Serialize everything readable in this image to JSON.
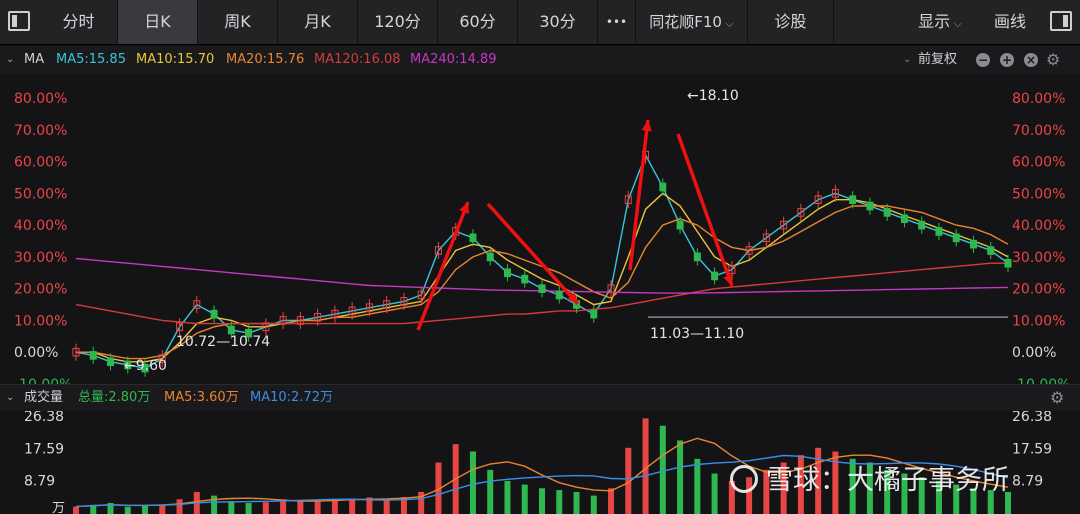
{
  "toolbar": {
    "tabs": [
      "分时",
      "日K",
      "周K",
      "月K",
      "120分",
      "60分",
      "30分",
      "•••",
      "同花顺F10",
      "诊股"
    ],
    "active_tab": "日K",
    "right_items": [
      "显示",
      "画线"
    ]
  },
  "ma_bar": {
    "label": "MA",
    "items": [
      {
        "text": "MA5:15.85",
        "color": "#36c6d9"
      },
      {
        "text": "MA10:15.70",
        "color": "#e8c63a"
      },
      {
        "text": "MA20:15.76",
        "color": "#e8862e"
      },
      {
        "text": "MA120:16.08",
        "color": "#d43b3b"
      },
      {
        "text": "MA240:14.89",
        "color": "#c737c7"
      }
    ],
    "adjust_label": "前复权"
  },
  "vol_bar": {
    "label": "成交量",
    "items": [
      {
        "text": "总量:2.80万",
        "color": "#2fb84f"
      },
      {
        "text": "MA5:3.60万",
        "color": "#e8862e"
      },
      {
        "text": "MA10:2.72万",
        "color": "#3a8ee6"
      }
    ]
  },
  "watermark": "雪球：大橘子事务所",
  "chart_data": [
    {
      "type": "candlestick",
      "title": "",
      "y_axis_ticks": [
        "80.00%",
        "70.00%",
        "60.00%",
        "50.00%",
        "40.00%",
        "30.00%",
        "20.00%",
        "10.00%",
        "0.00%",
        "-10.00%"
      ],
      "ylim": [
        -10,
        80
      ],
      "annotations": [
        "←18.10",
        "10.72—10.74",
        "←9.60",
        "11.03—11.10"
      ],
      "ma_series": [
        {
          "name": "MA5",
          "color": "#36c6d9",
          "values": [
            0,
            -1,
            -3,
            -4,
            -5,
            -2,
            8,
            15,
            12,
            7,
            6,
            8,
            10,
            10,
            11,
            12,
            13,
            14,
            15,
            16,
            18,
            32,
            38,
            36,
            30,
            25,
            23,
            20,
            18,
            15,
            12,
            20,
            48,
            62,
            52,
            40,
            30,
            24,
            26,
            32,
            36,
            40,
            44,
            48,
            50,
            48,
            46,
            44,
            42,
            40,
            38,
            36,
            34,
            32,
            28
          ]
        },
        {
          "name": "MA10",
          "color": "#e8c63a",
          "values": [
            0,
            0,
            -2,
            -3,
            -3,
            -2,
            3,
            9,
            11,
            10,
            8,
            8,
            9,
            10,
            10,
            11,
            12,
            13,
            14,
            15,
            16,
            24,
            32,
            34,
            33,
            29,
            26,
            23,
            21,
            18,
            15,
            16,
            30,
            45,
            50,
            46,
            38,
            30,
            27,
            29,
            33,
            37,
            41,
            45,
            48,
            48,
            47,
            45,
            43,
            41,
            39,
            37,
            35,
            33,
            30
          ]
        },
        {
          "name": "MA20",
          "color": "#e8862e",
          "values": [
            0,
            0,
            -1,
            -2,
            -2,
            -1,
            2,
            6,
            8,
            9,
            9,
            9,
            9,
            10,
            10,
            11,
            11,
            12,
            13,
            14,
            15,
            19,
            26,
            30,
            32,
            31,
            29,
            27,
            25,
            22,
            19,
            17,
            22,
            33,
            40,
            42,
            40,
            36,
            33,
            32,
            33,
            35,
            38,
            41,
            44,
            46,
            46,
            46,
            45,
            44,
            42,
            40,
            39,
            37,
            34
          ]
        },
        {
          "name": "MA120",
          "color": "#d43b3b",
          "values": [
            15,
            14,
            13,
            12,
            11,
            10,
            9.5,
            9,
            9,
            9,
            9,
            9,
            9,
            9,
            9,
            9,
            9,
            9,
            9,
            9,
            9.5,
            10,
            10.5,
            11,
            11.5,
            12,
            12,
            12.5,
            13,
            13,
            13.5,
            14,
            15,
            16,
            17,
            18,
            19,
            20,
            20.5,
            21,
            21.5,
            22,
            22.5,
            23,
            23.5,
            24,
            24.5,
            25,
            25.5,
            26,
            26.5,
            27,
            27.5,
            28,
            28
          ]
        },
        {
          "name": "MA240",
          "color": "#c737c7",
          "values": [
            29.5,
            29,
            28.5,
            28,
            27.5,
            27,
            26.5,
            26,
            25.5,
            25,
            24.5,
            24,
            23.5,
            23,
            22.5,
            22,
            21.5,
            21,
            20.8,
            20.6,
            20.4,
            20.2,
            20,
            19.8,
            19.6,
            19.5,
            19.4,
            19.3,
            19.2,
            19.1,
            19,
            18.9,
            18.8,
            18.7,
            18.6,
            18.6,
            18.6,
            18.7,
            18.8,
            18.9,
            19,
            19.1,
            19.2,
            19.3,
            19.4,
            19.5,
            19.6,
            19.7,
            19.8,
            19.9,
            20,
            20.1,
            20.2,
            20.3,
            20.4
          ]
        }
      ]
    },
    {
      "type": "bar",
      "title": "",
      "y_axis_ticks": [
        "26.38",
        "17.59",
        "8.79"
      ],
      "unit_label": "万",
      "ylim": [
        0,
        26.38
      ],
      "values": [
        2,
        2.5,
        3,
        2,
        2.2,
        2.6,
        4,
        6,
        5,
        3.5,
        3,
        3.2,
        4,
        3.8,
        3.5,
        4,
        4.2,
        4.5,
        4.2,
        4.6,
        6,
        14,
        19,
        17,
        12,
        9,
        8,
        7,
        6.5,
        6,
        5,
        7,
        18,
        26,
        24,
        20,
        15,
        11,
        9,
        10,
        12,
        14,
        16,
        18,
        17,
        15,
        14,
        12,
        11,
        10,
        9,
        8,
        7,
        6.5,
        6
      ]
    }
  ]
}
